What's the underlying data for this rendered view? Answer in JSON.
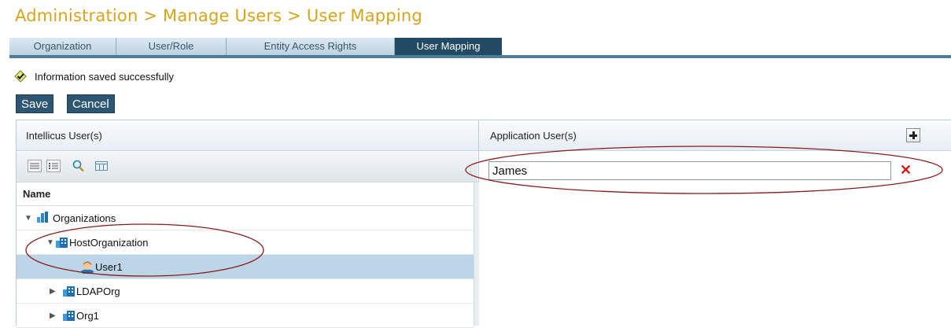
{
  "page": {
    "title": "Administration > Manage Users > User Mapping"
  },
  "tabs": [
    {
      "label": "Organization"
    },
    {
      "label": "User/Role"
    },
    {
      "label": "Entity Access Rights"
    },
    {
      "label": "User Mapping",
      "active": true
    }
  ],
  "status": {
    "message": "Information saved successfully",
    "icon": "check-icon"
  },
  "actions": {
    "save_label": "Save",
    "cancel_label": "Cancel"
  },
  "left_panel": {
    "title": "Intellicus User(s)",
    "column_header": "Name",
    "tree": [
      {
        "label": "Organizations",
        "expanded": true,
        "icon": "organizations-icon"
      },
      {
        "label": "HostOrganization",
        "expanded": true,
        "icon": "organization-icon"
      },
      {
        "label": "User1",
        "icon": "user-icon",
        "selected": true
      },
      {
        "label": "LDAPOrg",
        "expanded": false,
        "icon": "organization-icon"
      },
      {
        "label": "Org1",
        "expanded": false,
        "icon": "organization-icon"
      }
    ]
  },
  "right_panel": {
    "title": "Application User(s)",
    "mapped_user_value": "James"
  },
  "colors": {
    "title": "#d8a419",
    "active_tab": "#234a63",
    "selected_row": "#bcd6e7",
    "annotation": "#8b1a1a"
  }
}
